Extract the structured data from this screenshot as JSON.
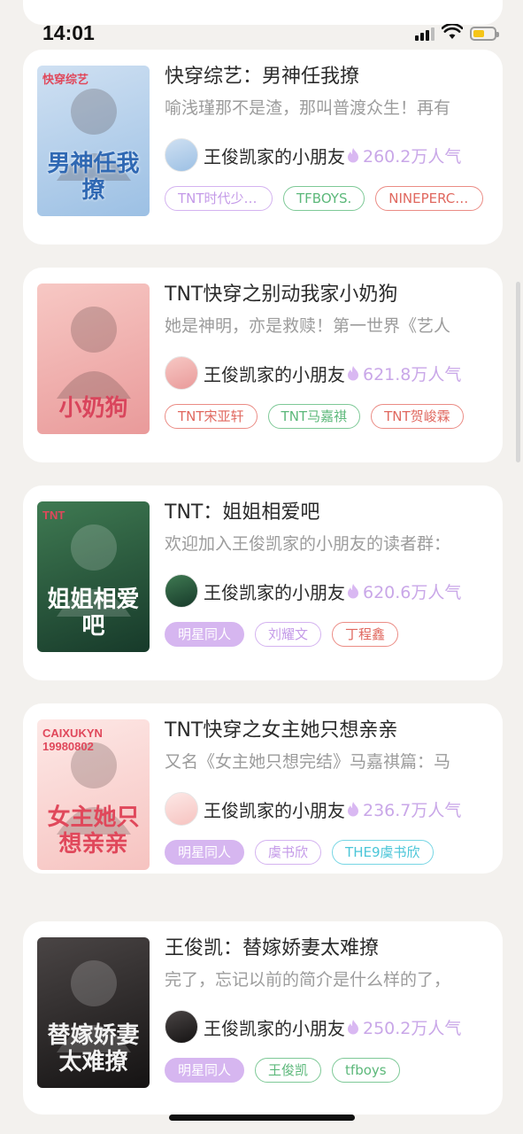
{
  "status_bar": {
    "time": "14:01"
  },
  "books": [
    {
      "title": "快穿综艺：男神任我撩",
      "description": "喻浅瑾那不是渣，那叫普渡众生！再有",
      "author": "王俊凯家的小朋友",
      "popularity": "260.2万人气",
      "cover_title": "男神任我撩",
      "cover_top": "快穿综艺",
      "cover_colors": [
        "#cfe0f2",
        "#9cc0e4"
      ],
      "cover_text_color": "#2f68b3",
      "tags": [
        {
          "label": "TNT时代少年团",
          "style": "purple"
        },
        {
          "label": "TFBOYS.",
          "style": "green"
        },
        {
          "label": "NINEPERCENT",
          "style": "red"
        }
      ]
    },
    {
      "title": "TNT快穿之别动我家小奶狗",
      "description": "她是神明，亦是救赎！第一世界《艺人",
      "author": "王俊凯家的小朋友",
      "popularity": "621.8万人气",
      "cover_title": "小奶狗",
      "cover_top": "",
      "cover_colors": [
        "#f7c8c4",
        "#e99a9a"
      ],
      "cover_text_color": "#d9455c",
      "tags": [
        {
          "label": "TNT宋亚轩",
          "style": "red"
        },
        {
          "label": "TNT马嘉祺",
          "style": "green"
        },
        {
          "label": "TNT贺峻霖",
          "style": "red"
        }
      ]
    },
    {
      "title": "TNT：姐姐相爱吧",
      "description": "欢迎加入王俊凯家的小朋友的读者群：",
      "author": "王俊凯家的小朋友",
      "popularity": "620.6万人气",
      "cover_title": "姐姐相爱吧",
      "cover_top": "TNT",
      "cover_colors": [
        "#3f7a52",
        "#173a2a"
      ],
      "cover_text_color": "#ffffff",
      "tags": [
        {
          "label": "明星同人",
          "style": "filled"
        },
        {
          "label": "刘耀文",
          "style": "purple"
        },
        {
          "label": "丁程鑫",
          "style": "red"
        }
      ]
    },
    {
      "title": "TNT快穿之女主她只想亲亲",
      "description": "又名《女主她只想完结》马嘉祺篇：马",
      "author": "王俊凯家的小朋友",
      "popularity": "236.7万人气",
      "cover_title": "女主她只想亲亲",
      "cover_top": "CAIXUKYN 19980802",
      "cover_colors": [
        "#fde8e6",
        "#f6c3c0"
      ],
      "cover_text_color": "#e0485b",
      "tags": [
        {
          "label": "明星同人",
          "style": "filled"
        },
        {
          "label": "虞书欣",
          "style": "purple"
        },
        {
          "label": "THE9虞书欣",
          "style": "cyan"
        }
      ]
    },
    {
      "title": "王俊凯：替嫁娇妻太难撩",
      "description": "完了，忘记以前的简介是什么样的了，",
      "author": "王俊凯家的小朋友",
      "popularity": "250.2万人气",
      "cover_title": "替嫁娇妻太难撩",
      "cover_top": "",
      "cover_colors": [
        "#4a4545",
        "#151313"
      ],
      "cover_text_color": "#f2f2f2",
      "tags": [
        {
          "label": "明星同人",
          "style": "filled"
        },
        {
          "label": "王俊凯",
          "style": "green"
        },
        {
          "label": "tfboys",
          "style": "green"
        }
      ]
    }
  ]
}
